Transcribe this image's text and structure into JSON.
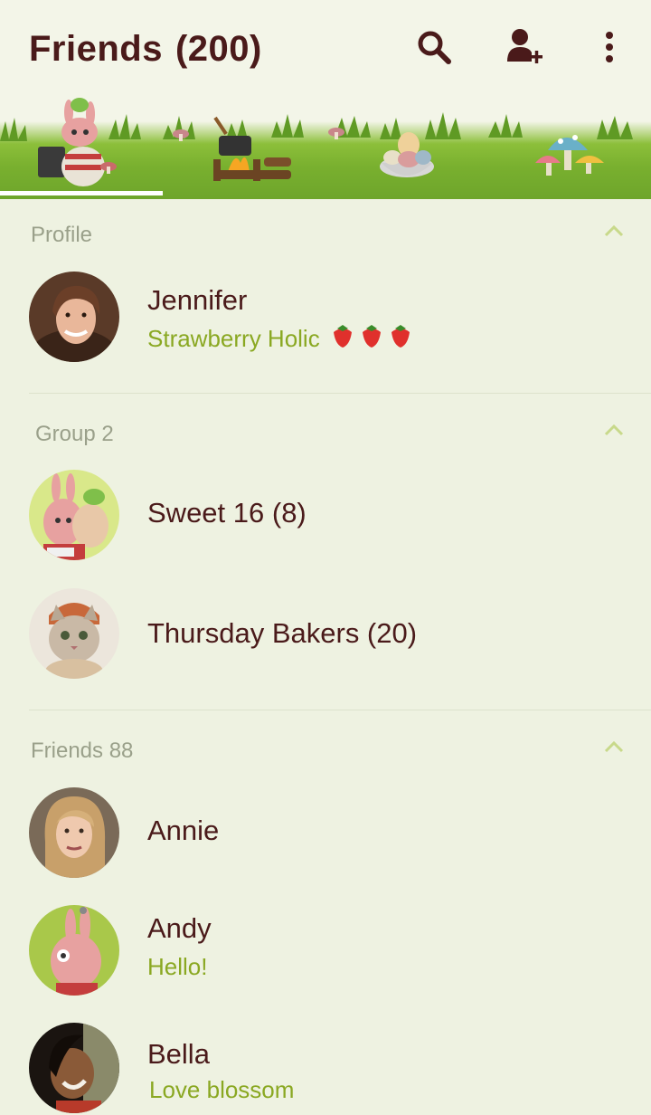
{
  "header": {
    "title": "Friends",
    "count": "(200)",
    "icons": [
      "search-icon",
      "add-friend-icon",
      "more-vertical-icon"
    ]
  },
  "banner": {
    "tabs": [
      "friends-tab",
      "chats-tab",
      "timeline-tab",
      "more-tab"
    ],
    "active_tab": 0
  },
  "sections": {
    "profile": {
      "label": "Profile"
    },
    "groups": {
      "label": "Group 2"
    },
    "friends": {
      "label": "Friends 88"
    }
  },
  "profile": {
    "name": "Jennifer",
    "status": "Strawberry Holic",
    "status_emoji_count": 3
  },
  "groups": [
    {
      "name": "Sweet 16 (8)"
    },
    {
      "name": "Thursday Bakers (20)"
    }
  ],
  "friends": [
    {
      "name": "Annie",
      "status": ""
    },
    {
      "name": "Andy",
      "status": "Hello!"
    },
    {
      "name": "Bella",
      "status": "Love blossom"
    }
  ],
  "colors": {
    "title": "#4a1a1a",
    "status": "#8aa822",
    "background": "#eef2e1",
    "section_label": "#9aa08a",
    "grass": "#79b02f"
  }
}
